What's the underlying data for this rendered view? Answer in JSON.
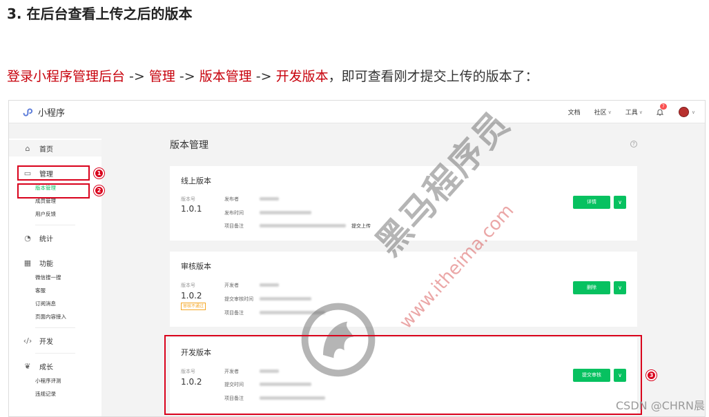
{
  "heading": "3. 在后台查看上传之后的版本",
  "intro": {
    "p1": "登录小程序管理后台",
    "a1": " -> ",
    "p2": "管理",
    "a2": " -> ",
    "p3": "版本管理",
    "a3": " -> ",
    "p4": "开发版本",
    "tail": "，即可查看刚才提交上传的版本了："
  },
  "topbar": {
    "app_name": "小程序",
    "docs": "文档",
    "community": "社区",
    "tools": "工具",
    "notify_count": "7"
  },
  "sidebar": {
    "home": "首页",
    "manage": "管理",
    "manage_items": [
      "版本管理",
      "成员管理",
      "用户反馈"
    ],
    "stats": "统计",
    "features": "功能",
    "feature_items": [
      "微信搜一搜",
      "客服",
      "订阅消息",
      "页面内容接入"
    ],
    "dev": "开发",
    "growth": "成长",
    "growth_items": [
      "小程序评测",
      "违规记录"
    ]
  },
  "main": {
    "title": "版本管理",
    "help": "?",
    "online": {
      "title": "线上版本",
      "version_label": "版本号",
      "version": "1.0.1",
      "publisher_label": "发布者",
      "publish_time_label": "发布时间",
      "note_label": "项目备注",
      "note_tail": "提交上传",
      "action": "详情"
    },
    "review": {
      "title": "审核版本",
      "version_label": "版本号",
      "version": "1.0.2",
      "status": "审核不通过",
      "dev_label": "开发者",
      "submit_time_label": "提交审核时间",
      "note_label": "项目备注",
      "action": "删除"
    },
    "dev": {
      "title": "开发版本",
      "version_label": "版本号",
      "version": "1.0.2",
      "dev_label": "开发者",
      "submit_time_label": "提交时间",
      "note_label": "项目备注",
      "action": "提交审核"
    }
  },
  "markers": [
    "1",
    "2",
    "3"
  ],
  "watermark": {
    "brand": "黑马程序员",
    "tm": "™",
    "url": "www.itheima.com",
    "credit": "CSDN @CHRN晨"
  },
  "colors": {
    "accent_green": "#07c160",
    "annotation_red": "#d9001b",
    "intro_red": "#c7000b"
  }
}
